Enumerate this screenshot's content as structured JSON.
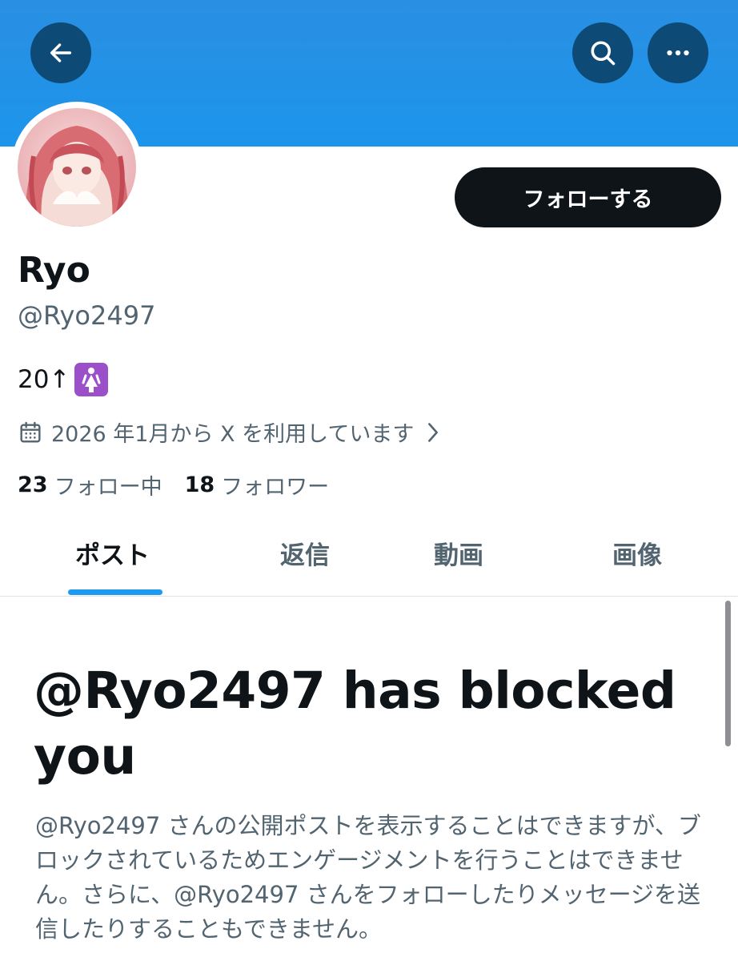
{
  "header": {
    "back_icon": "arrow-left-icon",
    "search_icon": "search-icon",
    "more_icon": "more-horizontal-icon",
    "banner_color": "#1d9bf0",
    "button_bg": "#0e4a76"
  },
  "profile": {
    "display_name": "Ryo",
    "handle": "@Ryo2497",
    "bio_text": "20↑",
    "bio_emoji": "womens-room-icon",
    "joined_text": "2026 年1月から X を利用しています",
    "follow_button_label": "フォローする",
    "following_count": "23",
    "following_label": "フォロー中",
    "followers_count": "18",
    "followers_label": "フォロワー"
  },
  "tabs": [
    {
      "label": "ポスト",
      "active": true
    },
    {
      "label": "返信",
      "active": false
    },
    {
      "label": "動画",
      "active": false
    },
    {
      "label": "画像",
      "active": false
    }
  ],
  "blocked": {
    "title": "@Ryo2497 has blocked you",
    "description": "@Ryo2497 さんの公開ポストを表示することはできますが、ブロックされているためエンゲージメントを行うことはできません。さらに、@Ryo2497 さんをフォローしたりメッセージを送信したりすることもできません。"
  },
  "colors": {
    "accent": "#1d9bf0",
    "text_primary": "#0f1419",
    "text_secondary": "#536471"
  }
}
